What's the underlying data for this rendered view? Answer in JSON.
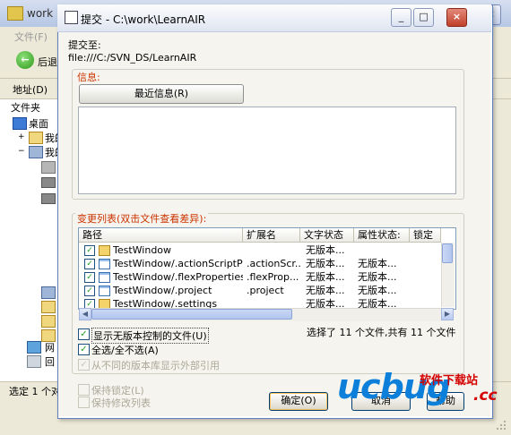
{
  "background_window": {
    "title": "work",
    "menu_file": "文件(F)",
    "back_label": "后退",
    "address_label": "地址(D)",
    "folders_label": "文件夹",
    "status_text": "选定 1 个对",
    "controls": {
      "minimize": "_",
      "maximize": "□",
      "close": "×"
    },
    "tree": [
      {
        "label": "桌面",
        "icon": "desktop-icon"
      },
      {
        "label": "我的",
        "icon": "documents-icon"
      },
      {
        "label": "我的",
        "icon": "computer-icon"
      },
      {
        "label": "网",
        "icon": "network-icon"
      },
      {
        "label": "回",
        "icon": "recycle-bin-icon"
      }
    ]
  },
  "dialog": {
    "title": "提交 - C:\\work\\LearnAIR",
    "submit_to_label": "提交至:",
    "submit_url": "file:///C:/SVN_DS/LearnAIR",
    "info_group_label": "信息:",
    "recent_messages_button": "最近信息(R)",
    "message_text": "",
    "changes_group_label": "变更列表(双击文件查看差异):",
    "columns": [
      "路径",
      "扩展名",
      "文字状态",
      "属性状态:",
      "锁定"
    ],
    "rows": [
      {
        "checked": true,
        "icon": "folder-icon",
        "path": "TestWindow",
        "ext": "",
        "text_status": "无版本...",
        "prop_status": ""
      },
      {
        "checked": true,
        "icon": "file-icon",
        "path": "TestWindow/.actionScriptPro...",
        "ext": ".actionScr...",
        "text_status": "无版本...",
        "prop_status": "无版本..."
      },
      {
        "checked": true,
        "icon": "file-icon",
        "path": "TestWindow/.flexProperties",
        "ext": ".flexProp...",
        "text_status": "无版本...",
        "prop_status": "无版本..."
      },
      {
        "checked": true,
        "icon": "file-icon",
        "path": "TestWindow/.project",
        "ext": ".project",
        "text_status": "无版本...",
        "prop_status": "无版本..."
      },
      {
        "checked": true,
        "icon": "folder-icon",
        "path": "TestWindow/.settings",
        "ext": "",
        "text_status": "无版本...",
        "prop_status": "无版本..."
      }
    ],
    "show_unversioned": {
      "label": "显示无版本控制的文件(U)",
      "checked": true
    },
    "select_all": {
      "label": "全选/全不选(A)",
      "checked": true
    },
    "show_externals": {
      "label": "从不同的版本库显示外部引用",
      "checked": true,
      "disabled": true
    },
    "selection_summary": "选择了 11 个文件,共有 11 个文件",
    "keep_locks": {
      "label": "保持锁定(L)",
      "checked": false,
      "disabled": true
    },
    "keep_changelists": {
      "label": "保持修改列表",
      "checked": false,
      "disabled": true
    },
    "ok_button": "确定(O)",
    "cancel_button": "取消",
    "help_button": "帮助",
    "controls": {
      "minimize": "_",
      "maximize": "□",
      "close": "×"
    }
  },
  "watermark": {
    "brand": "ucbug",
    "tagline": "软件下载站",
    "domain": ".cc"
  },
  "colors": {
    "group_label": "#cc3300",
    "watermark_blue": "#0b7fd9",
    "watermark_red": "#d40000",
    "titlebar_border": "#5f7fbf"
  }
}
